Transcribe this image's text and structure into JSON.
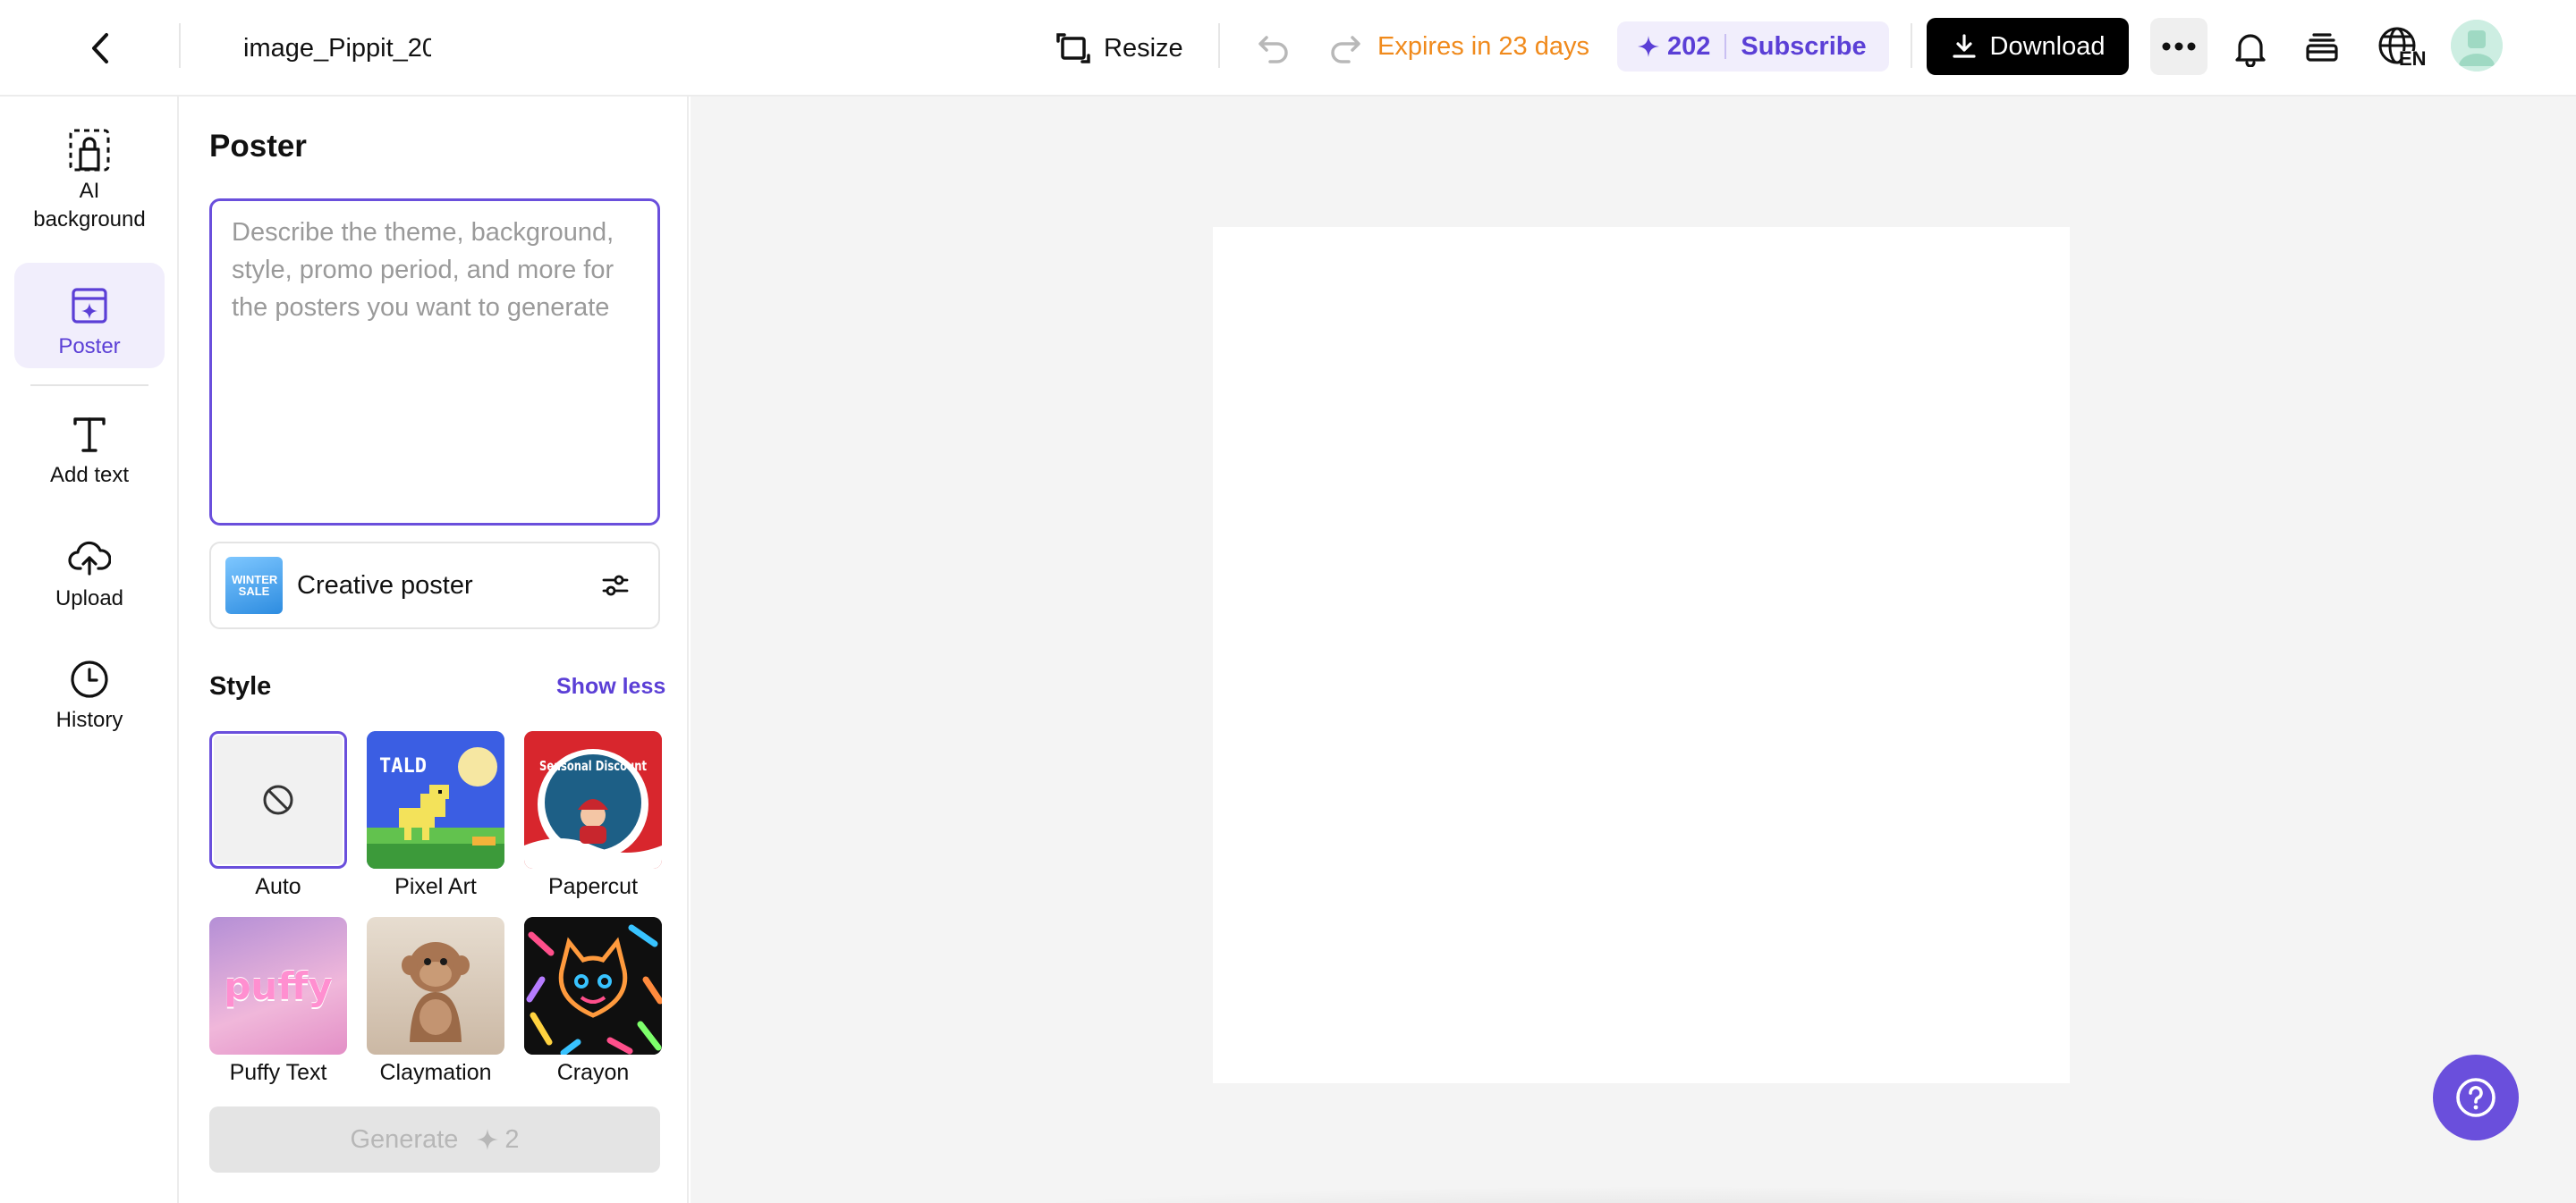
{
  "header": {
    "back_icon": "chevron-left-icon",
    "file_name": "image_Pippit_20",
    "resize_label": "Resize",
    "expires_text": "Expires in 23 days",
    "credits": "202",
    "subscribe_label": "Subscribe",
    "download_label": "Download",
    "language_code": "EN",
    "accent_color": "#5b3fd6",
    "expires_color": "#f08a1c"
  },
  "rail": {
    "items": [
      {
        "label": "AI background",
        "icon": "ai-background-icon"
      },
      {
        "label": "Poster",
        "icon": "poster-icon",
        "active": true
      },
      {
        "label": "Add text",
        "icon": "text-icon"
      },
      {
        "label": "Upload",
        "icon": "upload-icon"
      },
      {
        "label": "History",
        "icon": "history-icon"
      }
    ]
  },
  "panel": {
    "title": "Poster",
    "prompt_value": "",
    "prompt_placeholder": "Describe the theme, background, style, promo period, and more for the posters you want to generate",
    "poster_type": "Creative poster",
    "poster_type_thumb_text": "WINTER SALE",
    "style_title": "Style",
    "show_less_label": "Show less",
    "styles": [
      {
        "label": "Auto",
        "selected": true
      },
      {
        "label": "Pixel Art",
        "thumb_text": "TALD"
      },
      {
        "label": "Papercut",
        "thumb_text": "Seasonal Discount"
      },
      {
        "label": "Puffy Text",
        "thumb_text": "puffy"
      },
      {
        "label": "Claymation"
      },
      {
        "label": "Crayon"
      }
    ],
    "generate_label": "Generate",
    "generate_cost": "2"
  },
  "help_icon": "help-icon"
}
